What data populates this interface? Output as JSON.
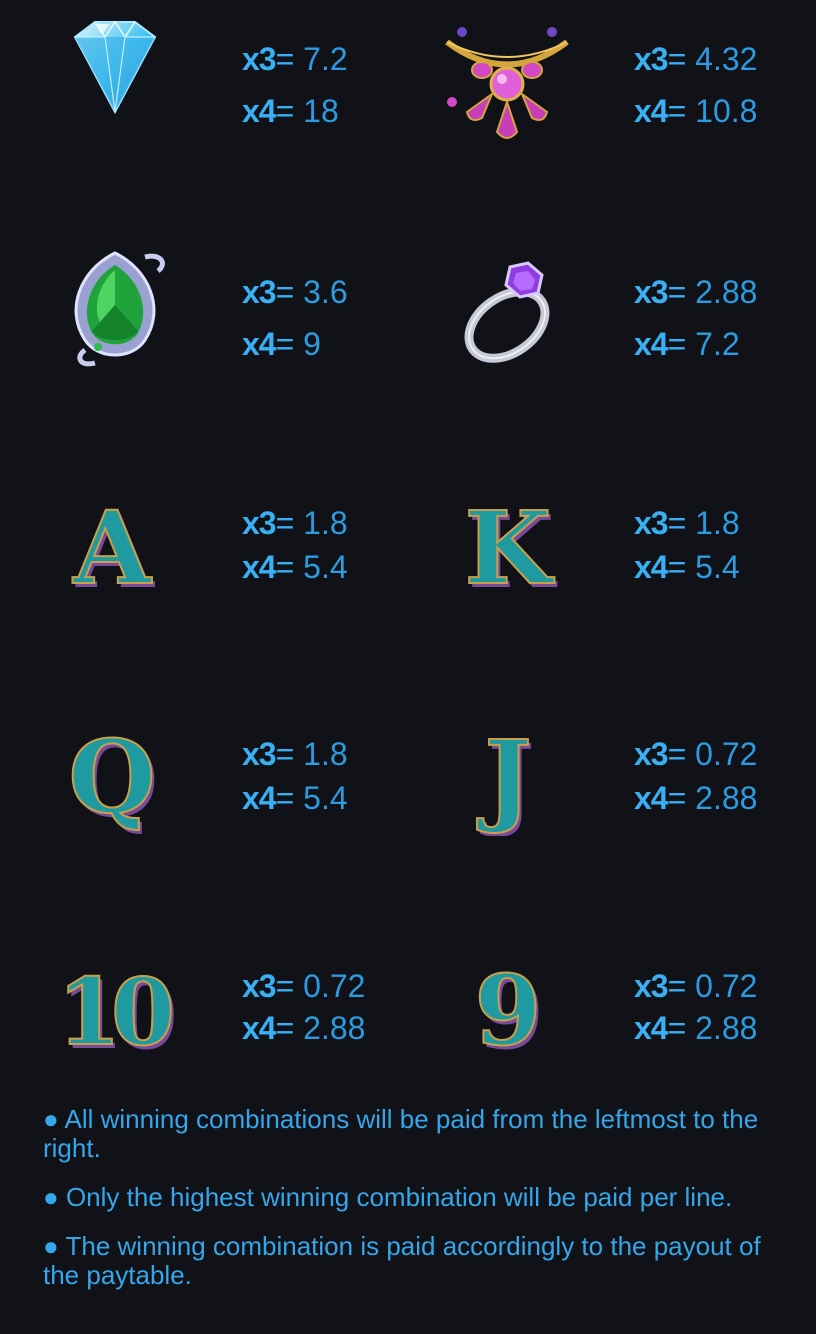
{
  "paytable": [
    {
      "symbol": "diamond",
      "icon": "diamond-icon",
      "x3": "7.2",
      "x4": "18"
    },
    {
      "symbol": "necklace",
      "icon": "necklace-icon",
      "x3": "4.32",
      "x4": "10.8"
    },
    {
      "symbol": "emerald-brooch",
      "icon": "emerald-brooch-icon",
      "x3": "3.6",
      "x4": "9"
    },
    {
      "symbol": "ring",
      "icon": "ring-icon",
      "x3": "2.88",
      "x4": "7.2"
    },
    {
      "symbol": "A",
      "icon": "letter-a-icon",
      "letter": "A",
      "x3": "1.8",
      "x4": "5.4"
    },
    {
      "symbol": "K",
      "icon": "letter-k-icon",
      "letter": "K",
      "x3": "1.8",
      "x4": "5.4"
    },
    {
      "symbol": "Q",
      "icon": "letter-q-icon",
      "letter": "Q",
      "x3": "1.8",
      "x4": "5.4"
    },
    {
      "symbol": "J",
      "icon": "letter-j-icon",
      "letter": "J",
      "x3": "0.72",
      "x4": "2.88"
    },
    {
      "symbol": "10",
      "icon": "number-10-icon",
      "letter": "10",
      "x3": "0.72",
      "x4": "2.88"
    },
    {
      "symbol": "9",
      "icon": "number-9-icon",
      "letter": "9",
      "x3": "0.72",
      "x4": "2.88"
    }
  ],
  "multipliers": {
    "x3": "x3",
    "x4": "x4",
    "eq": "="
  },
  "rules": [
    "All winning combinations will be paid from the leftmost to the right.",
    "Only the highest winning combination will be paid per line.",
    "The winning combination is paid accordingly to the payout of the paytable."
  ],
  "bullet": "●",
  "colors": {
    "background": "#101217",
    "text": "#36a6ea",
    "letter_teal": "#1f9aa0",
    "letter_gold": "#c9a04a"
  }
}
